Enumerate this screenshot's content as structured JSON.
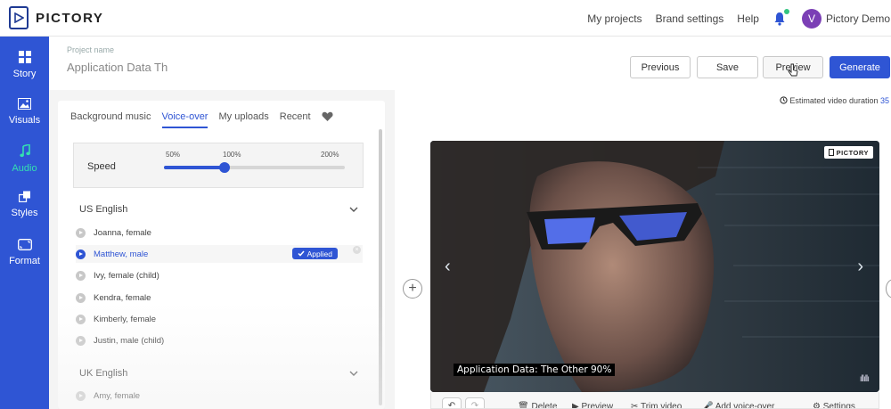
{
  "brand": {
    "name": "PICTORY",
    "color": "#2f55d4",
    "accent": "#34e0b0"
  },
  "topnav": {
    "links": [
      "My projects",
      "Brand settings",
      "Help"
    ],
    "user_initial": "V",
    "user_name": "Pictory Demo"
  },
  "sidebar": {
    "items": [
      {
        "label": "Story",
        "icon": "grid-icon",
        "active": false
      },
      {
        "label": "Visuals",
        "icon": "image-icon",
        "active": false
      },
      {
        "label": "Audio",
        "icon": "music-note-icon",
        "active": true
      },
      {
        "label": "Styles",
        "icon": "styles-icon",
        "active": false
      },
      {
        "label": "Format",
        "icon": "format-icon",
        "active": false
      }
    ]
  },
  "project": {
    "label": "Project name",
    "value": "Application Data Th"
  },
  "actions": {
    "previous": "Previous",
    "save": "Save",
    "preview": "Preview",
    "generate": "Generate"
  },
  "tabs": [
    "Background music",
    "Voice-over",
    "My uploads",
    "Recent"
  ],
  "active_tab": "Voice-over",
  "speed": {
    "label": "Speed",
    "ticks": [
      "50%",
      "100%",
      "200%"
    ],
    "value_percent": 100
  },
  "voices": {
    "groups": [
      {
        "name": "US English",
        "items": [
          "Joanna, female",
          "Matthew, male",
          "Ivy, female (child)",
          "Kendra, female",
          "Kimberly, female",
          "Justin, male (child)"
        ]
      },
      {
        "name": "UK English",
        "items": [
          "Amy, female"
        ]
      }
    ],
    "selected": "Matthew, male",
    "applied_label": "Applied"
  },
  "duration": {
    "label": "Estimated video duration",
    "value": "35"
  },
  "video": {
    "watermark": "PICTORY",
    "caption": "Application Data: The Other 90%"
  },
  "video_toolbar": [
    "Delete",
    "Preview",
    "Trim video",
    "Add voice-over",
    "Settings"
  ]
}
